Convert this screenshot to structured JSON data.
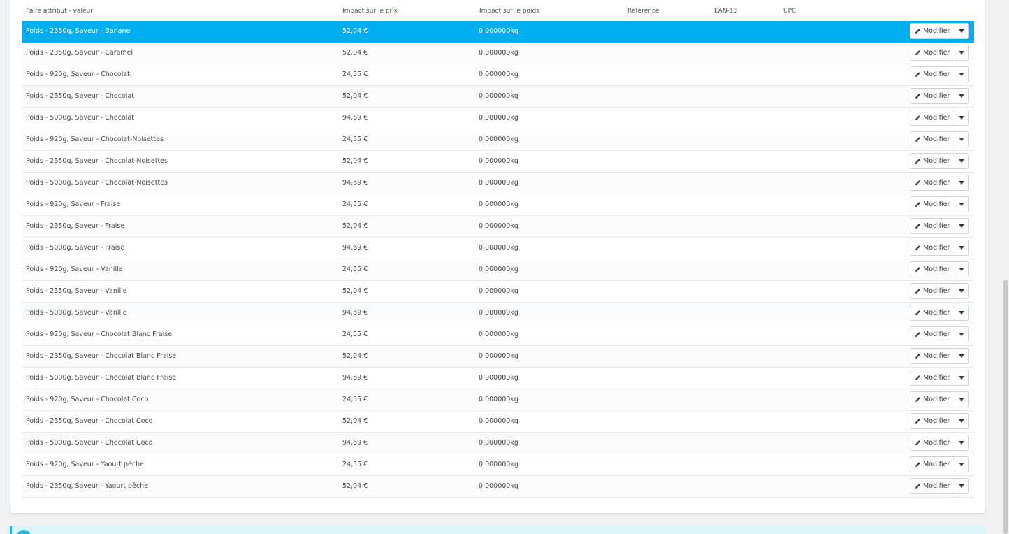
{
  "table": {
    "headers": {
      "attribute": "Paire attribut - valeur",
      "price": "Impact sur le prix",
      "weight": "Impact sur le poids",
      "reference": "Référence",
      "ean": "EAN-13",
      "upc": "UPC"
    },
    "modify_label": "Modifier",
    "rows": [
      {
        "name": "Poids - 2350g, Saveur - Banane",
        "price": "52,04 €",
        "weight": "0.000000kg",
        "selected": true
      },
      {
        "name": "Poids - 2350g, Saveur - Caramel",
        "price": "52,04 €",
        "weight": "0.000000kg"
      },
      {
        "name": "Poids - 920g, Saveur - Chocolat",
        "price": "24,55 €",
        "weight": "0.000000kg"
      },
      {
        "name": "Poids - 2350g, Saveur - Chocolat",
        "price": "52,04 €",
        "weight": "0.000000kg"
      },
      {
        "name": "Poids - 5000g, Saveur - Chocolat",
        "price": "94,69 €",
        "weight": "0.000000kg"
      },
      {
        "name": "Poids - 920g, Saveur - Chocolat-Noisettes",
        "price": "24,55 €",
        "weight": "0.000000kg"
      },
      {
        "name": "Poids - 2350g, Saveur - Chocolat-Noisettes",
        "price": "52,04 €",
        "weight": "0.000000kg"
      },
      {
        "name": "Poids - 5000g, Saveur - Chocolat-Noisettes",
        "price": "94,69 €",
        "weight": "0.000000kg"
      },
      {
        "name": "Poids - 920g, Saveur - Fraise",
        "price": "24,55 €",
        "weight": "0.000000kg"
      },
      {
        "name": "Poids - 2350g, Saveur - Fraise",
        "price": "52,04 €",
        "weight": "0.000000kg"
      },
      {
        "name": "Poids - 5000g, Saveur - Fraise",
        "price": "94,69 €",
        "weight": "0.000000kg"
      },
      {
        "name": "Poids - 920g, Saveur - Vanille",
        "price": "24,55 €",
        "weight": "0.000000kg"
      },
      {
        "name": "Poids - 2350g, Saveur - Vanille",
        "price": "52,04 €",
        "weight": "0.000000kg"
      },
      {
        "name": "Poids - 5000g, Saveur - Vanille",
        "price": "94,69 €",
        "weight": "0.000000kg"
      },
      {
        "name": "Poids - 920g, Saveur - Chocolat Blanc Fraise",
        "price": "24,55 €",
        "weight": "0.000000kg"
      },
      {
        "name": "Poids - 2350g, Saveur - Chocolat Blanc Fraise",
        "price": "52,04 €",
        "weight": "0.000000kg"
      },
      {
        "name": "Poids - 5000g, Saveur - Chocolat Blanc Fraise",
        "price": "94,69 €",
        "weight": "0.000000kg"
      },
      {
        "name": "Poids - 920g, Saveur - Chocolat Coco",
        "price": "24,55 €",
        "weight": "0.000000kg"
      },
      {
        "name": "Poids - 2350g, Saveur - Chocolat Coco",
        "price": "52,04 €",
        "weight": "0.000000kg"
      },
      {
        "name": "Poids - 5000g, Saveur - Chocolat Coco",
        "price": "94,69 €",
        "weight": "0.000000kg"
      },
      {
        "name": "Poids - 920g, Saveur - Yaourt pêche",
        "price": "24,55 €",
        "weight": "0.000000kg"
      },
      {
        "name": "Poids - 2350g, Saveur - Yaourt pêche",
        "price": "52,04 €",
        "weight": "0.000000kg"
      }
    ]
  },
  "colors": {
    "selected_row": "#00aff0",
    "info_accent": "#25b9d7"
  },
  "icons": {
    "modify": "pencil-icon",
    "dropdown": "caret-down-icon",
    "info": "info-icon"
  }
}
